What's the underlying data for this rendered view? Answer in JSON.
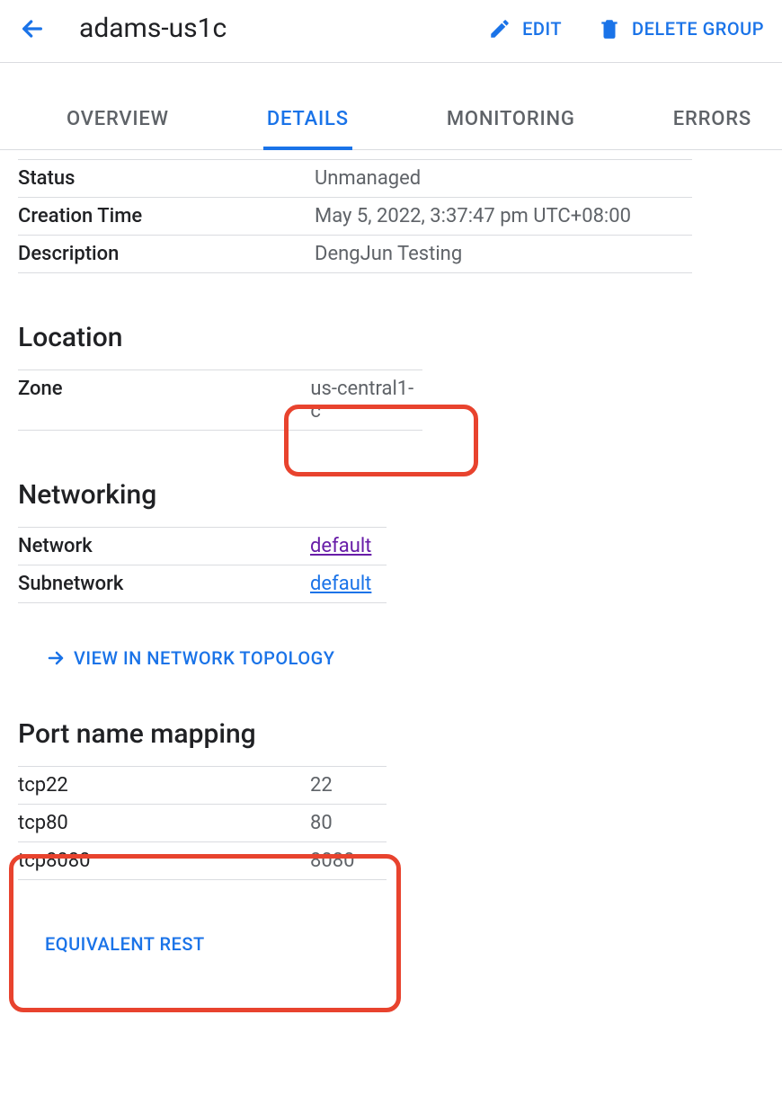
{
  "header": {
    "title": "adams-us1c",
    "edit_label": "EDIT",
    "delete_label": "DELETE GROUP"
  },
  "tabs": {
    "overview": "OVERVIEW",
    "details": "DETAILS",
    "monitoring": "MONITORING",
    "errors": "ERRORS"
  },
  "details": {
    "status_label": "Status",
    "status_value": "Unmanaged",
    "creation_label": "Creation Time",
    "creation_value": "May 5, 2022, 3:37:47 pm UTC+08:00",
    "description_label": "Description",
    "description_value": "DengJun Testing"
  },
  "location": {
    "heading": "Location",
    "zone_label": "Zone",
    "zone_value": "us-central1-c"
  },
  "networking": {
    "heading": "Networking",
    "network_label": "Network",
    "network_value": "default",
    "subnetwork_label": "Subnetwork",
    "subnetwork_value": "default",
    "view_topology": "VIEW IN NETWORK TOPOLOGY"
  },
  "port_mapping": {
    "heading": "Port name mapping",
    "rows": [
      {
        "name": "tcp22",
        "port": "22"
      },
      {
        "name": "tcp80",
        "port": "80"
      },
      {
        "name": "tcp8080",
        "port": "8080"
      }
    ]
  },
  "equivalent_rest": "EQUIVALENT REST"
}
